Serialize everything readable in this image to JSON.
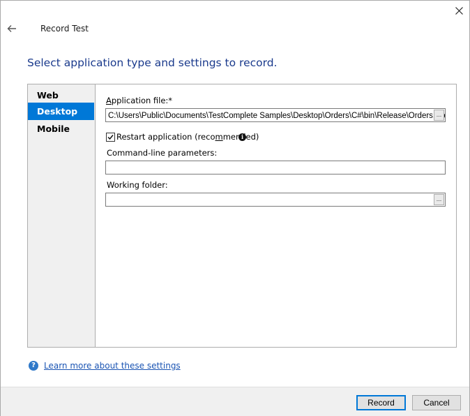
{
  "window": {
    "title": "Record Test",
    "heading": "Select application type and settings to record."
  },
  "sidebar": {
    "items": [
      {
        "label": "Web"
      },
      {
        "label": "Desktop",
        "selected": true
      },
      {
        "label": "Mobile"
      }
    ]
  },
  "form": {
    "application_file": {
      "label_prefix": "A",
      "label_rest": "pplication file:*",
      "value": "C:\\Users\\Public\\Documents\\TestComplete Samples\\Desktop\\Orders\\C#\\bin\\Release\\Orders.exe",
      "browse_label": "..."
    },
    "restart": {
      "label_before": "Restart application (reco",
      "label_mnemonic": "m",
      "label_after": "mended)",
      "checked": true
    },
    "command_line": {
      "label": "Command-line parameters:",
      "value": ""
    },
    "working_folder": {
      "label": "Working folder:",
      "value": "",
      "browse_label": "..."
    }
  },
  "help": {
    "link_text": "Learn more about these settings"
  },
  "buttons": {
    "record": "Record",
    "cancel": "Cancel"
  },
  "colors": {
    "accent": "#0078d7",
    "heading": "#1a3a8c",
    "link": "#1a54b3"
  }
}
